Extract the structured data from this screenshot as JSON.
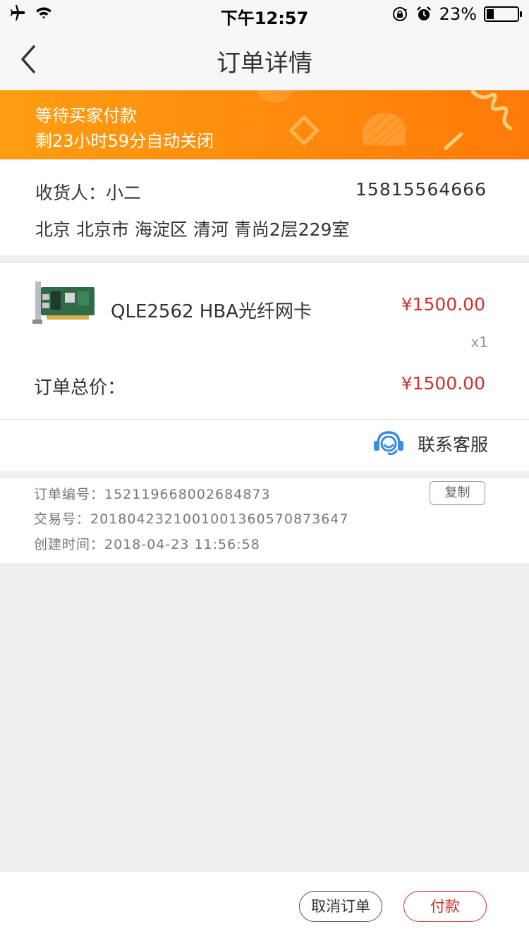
{
  "status_bar": {
    "time": "下午12:57",
    "battery_text": "23%",
    "battery_level": 0.23,
    "icons": [
      "airplane-mode-icon",
      "wifi-icon",
      "rotation-lock-icon",
      "alarm-icon",
      "battery-icon"
    ]
  },
  "nav": {
    "title": "订单详情",
    "back_icon": "chevron-left-icon"
  },
  "banner": {
    "status": "等待买家付款",
    "countdown": "剩23小时59分自动关闭",
    "color_start": "#ff9d12",
    "color_end": "#ff7a0a"
  },
  "address": {
    "receiver_label": "收货人：",
    "receiver_name": "小二",
    "phone": "15815564666",
    "full_address": "北京 北京市 海淀区 清河 青尚2层229室"
  },
  "product": {
    "name": "QLE2562  HBA光纤网卡",
    "price": "¥1500.00",
    "quantity": "x1"
  },
  "total": {
    "label": "订单总价：",
    "value": "¥1500.00"
  },
  "service": {
    "label": "联系客服",
    "icon": "customer-service-icon"
  },
  "order_info": {
    "order_no": "订单编号：152119668002684873",
    "trade_no": "交易号：2018042321001001360570873647",
    "created": "创建时间：2018-04-23   11:56:58",
    "copy_label": "复制"
  },
  "actions": {
    "cancel": "取消订单",
    "pay": "付款"
  },
  "colors": {
    "accent_red": "#d0312d",
    "service_blue": "#3b8be0"
  }
}
